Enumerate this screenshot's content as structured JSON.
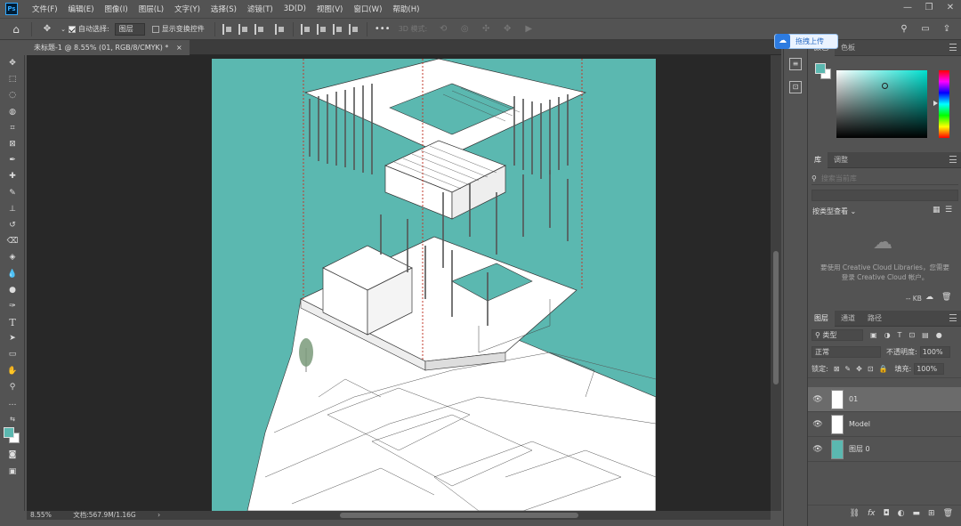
{
  "app": {
    "logo": "Ps"
  },
  "menu": [
    "文件(F)",
    "编辑(E)",
    "图像(I)",
    "图层(L)",
    "文字(Y)",
    "选择(S)",
    "滤镜(T)",
    "3D(D)",
    "视图(V)",
    "窗口(W)",
    "帮助(H)"
  ],
  "window_controls": [
    "minimize-icon",
    "restore-icon",
    "close-icon"
  ],
  "options_bar": {
    "auto_select_label": "自动选择:",
    "auto_select_value": "图层",
    "show_transform_label": "显示变换控件",
    "mode_3d_label": "3D 模式:"
  },
  "upload": {
    "label": "拖拽上传"
  },
  "document": {
    "tab_title": "未标题-1 @ 8.55% (01, RGB/8/CMYK) *"
  },
  "status": {
    "zoom": "8.55%",
    "doc_size": "文档:567.9M/1.16G"
  },
  "colors": {
    "foreground": "#5bb8b0",
    "background": "#ffffff",
    "canvas_bg": "#5bb8b0"
  },
  "color_panel": {
    "tabs": [
      "颜色",
      "色板"
    ]
  },
  "library_panel": {
    "tabs": [
      "库",
      "调整"
    ],
    "search_placeholder": "搜索当前库",
    "view_by": "按类型查看",
    "message": "要使用 Creative Cloud Libraries，您需要登录 Creative Cloud 帐户。",
    "size": "-- KB"
  },
  "layers_panel": {
    "tabs": [
      "图层",
      "通道",
      "路径"
    ],
    "filter": "类型",
    "blend_mode": "正常",
    "opacity_label": "不透明度:",
    "opacity_value": "100%",
    "lock_label": "锁定:",
    "fill_label": "填充:",
    "fill_value": "100%",
    "layers": [
      {
        "name": "01",
        "selected": true
      },
      {
        "name": "Model",
        "selected": false
      },
      {
        "name": "图层 0",
        "selected": false
      }
    ]
  }
}
